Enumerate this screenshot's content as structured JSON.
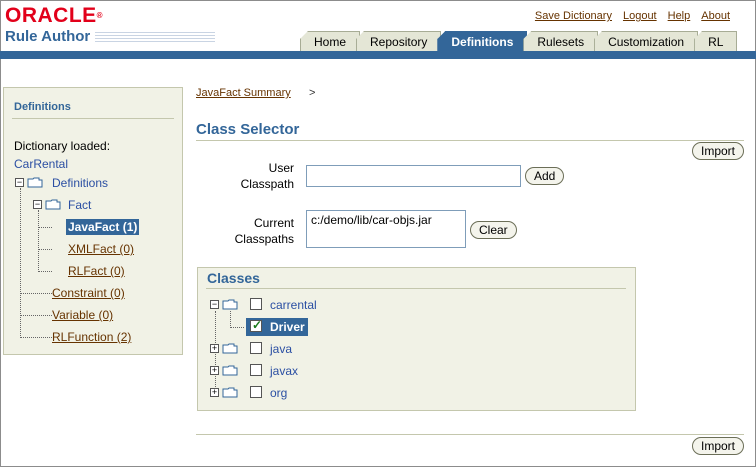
{
  "header": {
    "logo_text": "ORACLE",
    "product": "Rule Author",
    "links": [
      "Save Dictionary",
      "Logout",
      "Help",
      "About"
    ]
  },
  "tabs": [
    {
      "label": "Home",
      "active": false
    },
    {
      "label": "Repository",
      "active": false
    },
    {
      "label": "Definitions",
      "active": true
    },
    {
      "label": "Rulesets",
      "active": false
    },
    {
      "label": "Customization",
      "active": false
    },
    {
      "label": "RL",
      "active": false
    }
  ],
  "sidebar": {
    "title": "Definitions",
    "dict_label": "Dictionary loaded:",
    "dict_name": "CarRental",
    "tree": {
      "root": "Definitions",
      "fact": "Fact",
      "fact_children": [
        "JavaFact (1)",
        "XMLFact (0)",
        "RLFact (0)"
      ],
      "others": [
        "Constraint (0)",
        "Variable (0)",
        "RLFunction (2)"
      ]
    }
  },
  "main": {
    "breadcrumb": "JavaFact Summary",
    "breadcrumb_sep": ">",
    "title": "Class Selector",
    "import_label": "Import",
    "user_classpath_label": [
      "User",
      "Classpath"
    ],
    "user_classpath_value": "",
    "add_label": "Add",
    "current_classpaths_label": [
      "Current",
      "Classpaths"
    ],
    "current_classpaths": "c:/demo/lib/car-objs.jar",
    "clear_label": "Clear"
  },
  "classes": {
    "title": "Classes",
    "items": [
      {
        "name": "carrental",
        "checked": false,
        "selected": false
      },
      {
        "name": "Driver",
        "checked": true,
        "selected": true
      },
      {
        "name": "java",
        "checked": false,
        "selected": false
      },
      {
        "name": "javax",
        "checked": false,
        "selected": false
      },
      {
        "name": "org",
        "checked": false,
        "selected": false
      }
    ]
  },
  "icons": {
    "folder": "folder-icon",
    "expand": "expand-icon",
    "collapse": "collapse-icon",
    "checkbox": "checkbox-icon"
  }
}
